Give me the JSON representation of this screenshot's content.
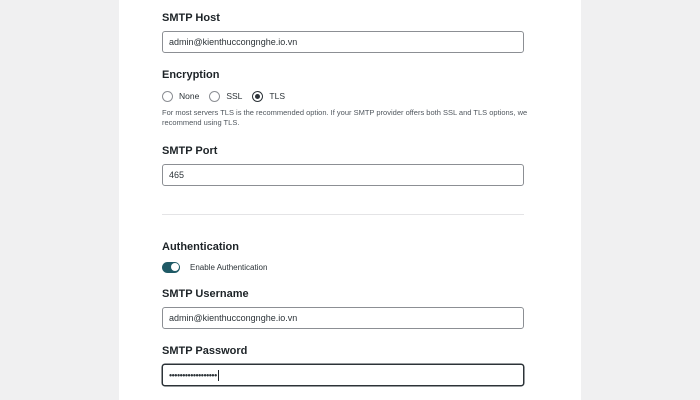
{
  "smtp_host": {
    "label": "SMTP Host",
    "value": "admin@kienthuccongnghe.io.vn"
  },
  "encryption": {
    "label": "Encryption",
    "options": [
      {
        "label": "None",
        "checked": false
      },
      {
        "label": "SSL",
        "checked": false
      },
      {
        "label": "TLS",
        "checked": true
      }
    ],
    "help_text": "For most servers TLS is the recommended option. If your SMTP provider offers both SSL and TLS options, we recommend using TLS."
  },
  "smtp_port": {
    "label": "SMTP Port",
    "value": "465"
  },
  "authentication": {
    "label": "Authentication",
    "toggle_label": "Enable Authentication",
    "enabled": true
  },
  "smtp_username": {
    "label": "SMTP Username",
    "value": "admin@kienthuccongnghe.io.vn"
  },
  "smtp_password": {
    "label": "SMTP Password",
    "value": "••••••••••••••••••"
  },
  "colors": {
    "toggle_on": "#1f5a66",
    "text": "#1d2327",
    "border": "#8c8f94",
    "background": "#f0f0f1",
    "panel": "#ffffff"
  }
}
